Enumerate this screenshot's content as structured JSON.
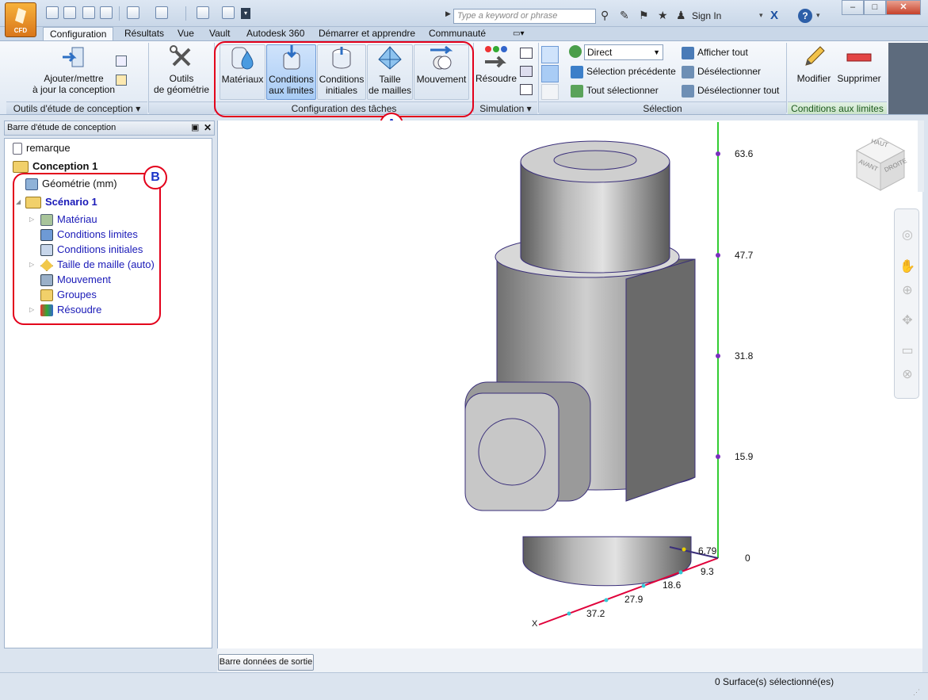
{
  "app": {
    "badge": "CFD"
  },
  "search": {
    "placeholder": "Type a keyword or phrase"
  },
  "account": {
    "sign_in": "Sign In"
  },
  "window_controls": {
    "minimize": "–",
    "maximize": "□",
    "close": "✕"
  },
  "tabs": [
    "Configuration",
    "Résultats",
    "Vue",
    "Vault",
    "Autodesk 360",
    "Démarrer et apprendre",
    "Communauté"
  ],
  "ribbon": {
    "groups": {
      "design_tools": "Outils d'étude de conception",
      "setup_tasks": "Configuration des tâches",
      "simulation": "Simulation",
      "selection": "Sélection",
      "boundary": "Conditions aux limites"
    },
    "buttons": {
      "add_update": [
        "Ajouter/mettre",
        "à jour la conception"
      ],
      "geometry_tools": [
        "Outils",
        "de géométrie"
      ],
      "materials": "Matériaux",
      "boundary_conditions": [
        "Conditions",
        "aux limites"
      ],
      "initial_conditions": [
        "Conditions",
        "initiales"
      ],
      "mesh_size": [
        "Taille",
        "de mailles"
      ],
      "motion": "Mouvement",
      "solve": "Résoudre",
      "modify": "Modifier",
      "delete": "Supprimer"
    },
    "selection": {
      "mode": "Direct",
      "previous": "Sélection précédente",
      "select_all": "Tout sélectionner",
      "show_all": "Afficher tout",
      "deselect": "Désélectionner",
      "deselect_all": "Désélectionner tout"
    }
  },
  "annotations": {
    "a": "A",
    "b": "B"
  },
  "panel": {
    "title": "Barre d'étude de conception",
    "tree": {
      "note": "remarque",
      "design": "Conception 1",
      "geometry": "Géométrie (mm)",
      "scenario": "Scénario 1",
      "material": "Matériau",
      "bc": "Conditions limites",
      "ic": "Conditions initiales",
      "mesh": "Taille de maille (auto)",
      "motion": "Mouvement",
      "groups": "Groupes",
      "solve": "Résoudre"
    }
  },
  "viewport": {
    "viewcube": {
      "top": "HAUT",
      "front": "AVANT",
      "right": "DROITE"
    },
    "z_ticks": [
      "63.6",
      "47.7",
      "31.8",
      "15.9",
      "0"
    ],
    "x_ticks": [
      "6.79",
      "9.3",
      "18.6",
      "27.9",
      "37.2"
    ],
    "x_axis_label": "X"
  },
  "output_bar": {
    "label": "Barre données de sortie"
  },
  "status": {
    "text": "0 Surface(s) sélectionné(es)"
  },
  "colors": {
    "annotation": "#e3001b",
    "annotation_text": "#1a33c8",
    "z_axis": "#33cc33",
    "x_axis": "#e0003a",
    "tree_link": "#1a1ab8"
  }
}
